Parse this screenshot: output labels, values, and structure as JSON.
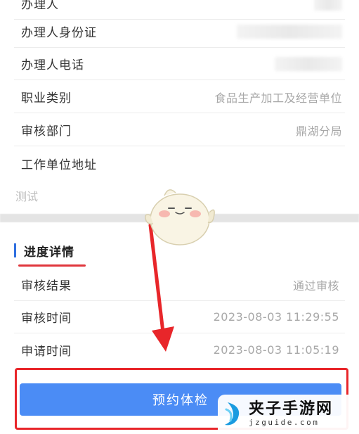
{
  "info": {
    "rows": [
      {
        "label": "办理人",
        "value": ""
      },
      {
        "label": "办理人身份证",
        "value": ""
      },
      {
        "label": "办理人电话",
        "value": ""
      },
      {
        "label": "职业类别",
        "value": "食品生产加工及经营单位"
      },
      {
        "label": "审核部门",
        "value": "鼎湖分局"
      },
      {
        "label": "工作单位地址",
        "value": ""
      }
    ],
    "note": "测试"
  },
  "progress": {
    "title": "进度详情",
    "rows": [
      {
        "label": "审核结果",
        "value": "通过审核"
      },
      {
        "label": "审核时间",
        "value": "2023-08-03 11:29:55"
      },
      {
        "label": "申请时间",
        "value": "2023-08-03 11:05:19"
      }
    ]
  },
  "actions": {
    "book_exam_label": "预约体检"
  },
  "watermark": {
    "title": "夹子手游网",
    "domain": "jzguide.com"
  },
  "colors": {
    "accent_blue": "#4b8cf5",
    "highlight_red": "#e8262a",
    "section_bar": "#2f6fe0"
  }
}
